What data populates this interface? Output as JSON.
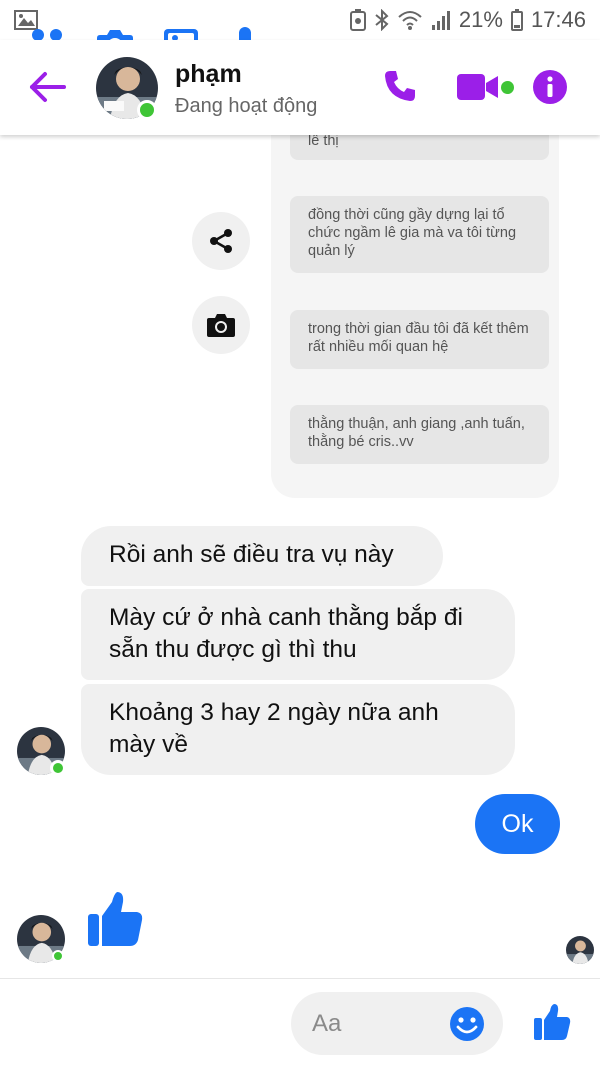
{
  "status_bar": {
    "battery": "21%",
    "time": "17:46"
  },
  "header": {
    "name": "phạm",
    "status": "Đang hoạt động"
  },
  "shared_messages": [
    "lê thị",
    "đồng thời cũng gầy dựng lại tổ chức ngầm lê gia mà va tôi từng quản lý",
    "trong thời gian đầu tôi đã kết thêm rất nhiều mối quan hệ",
    "thằng thuận, anh giang ,anh tuấn, thằng bé cris..vv"
  ],
  "incoming": [
    "Rồi anh sẽ điều tra vụ này",
    "Mày cứ ở nhà canh thằng bắp đi sẵn thu được gì thì thu",
    "Khoảng 3 hay 2 ngày nữa anh mày về"
  ],
  "outgoing": [
    "Ok"
  ],
  "composer": {
    "placeholder": "Aa"
  },
  "colors": {
    "accent_purple": "#9b1fe8",
    "messenger_blue": "#1b74f5",
    "online_green": "#3fc536"
  }
}
